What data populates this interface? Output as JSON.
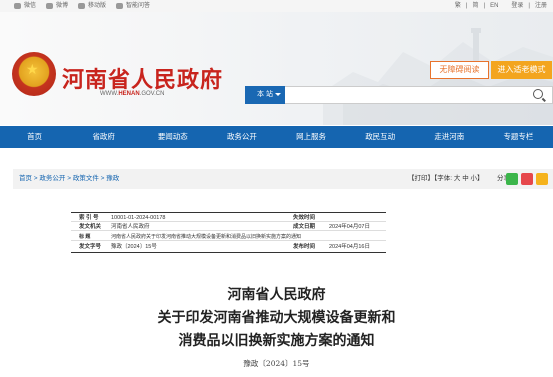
{
  "topbar": {
    "links": [
      {
        "icon": "wechat-icon",
        "label": "微信"
      },
      {
        "icon": "weibo-icon",
        "label": "微博"
      },
      {
        "icon": "mobile-icon",
        "label": "移动版"
      },
      {
        "icon": "smart-qa-icon",
        "label": "智能问答"
      }
    ],
    "lang_simplified": "繁",
    "lang_traditional": "简",
    "lang_en": "EN",
    "login": "登录",
    "register": "注册"
  },
  "header": {
    "site_title": "河南省人民政府",
    "site_url_prefix": "WWW.",
    "site_url_brand": "HENAN",
    "site_url_suffix": ".GOV.CN",
    "btn_accessible": "无障碍阅读",
    "btn_elder": "进入适老模式",
    "search_scope": "本  站",
    "search_placeholder": ""
  },
  "nav": [
    "首页",
    "省政府",
    "要闻动态",
    "政务公开",
    "网上服务",
    "政民互动",
    "走进河南",
    "专题专栏"
  ],
  "breadcrumb": {
    "home": "首页",
    "sep": " > ",
    "l1": "政务公开",
    "l2": "政策文件",
    "l3": "豫政",
    "print": "【打印】",
    "font_label": "【字体: ",
    "font_large": "大",
    "font_mid": "中",
    "font_small": "小",
    "font_end": "】",
    "share_label": "分享:"
  },
  "meta": {
    "rows": [
      {
        "k": "索  引  号",
        "v": "10001-01-2024-00178",
        "k2": "失效时间",
        "v2": ""
      },
      {
        "k": "发文机关",
        "v": "河南省人民政府",
        "k2": "成文日期",
        "v2": "2024年04月07日"
      },
      {
        "k": "标      题",
        "v": "河南省人民政府关于印发河南省推动大规模设备更新和消费品以旧换新实施方案的通知",
        "k2": "",
        "v2": ""
      },
      {
        "k": "发文字号",
        "v": "豫政〔2024〕15号",
        "k2": "发布时间",
        "v2": "2024年04月16日"
      }
    ]
  },
  "document": {
    "issuer": "河南省人民政府",
    "title_line1": "关于印发河南省推动大规模设备更新和",
    "title_line2": "消费品以旧换新实施方案的通知",
    "doc_number": "豫政〔2024〕15号"
  },
  "colors": {
    "brand_red": "#c8241d",
    "nav_blue": "#1565b0",
    "elder_orange": "#f3a51f"
  }
}
